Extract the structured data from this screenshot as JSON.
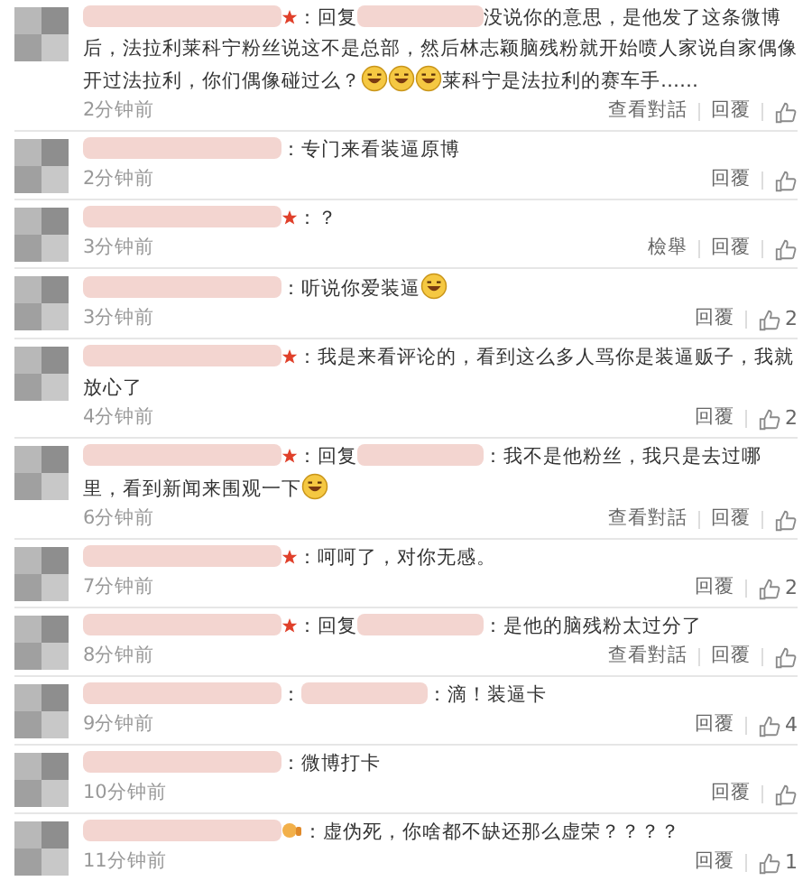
{
  "comments": [
    {
      "starred": true,
      "medal": false,
      "parts": [
        {
          "kind": "text",
          "text": "：回复"
        },
        {
          "kind": "blur"
        },
        {
          "kind": "text",
          "text": "没说你的意思，是他发了这条微博后，法拉利莱科宁粉丝说这不是总部，然后林志颖脑残粉就开始喷人家说自家偶像开过法拉利，你们偶像碰过么？"
        },
        {
          "kind": "emoji"
        },
        {
          "kind": "emoji"
        },
        {
          "kind": "emoji"
        },
        {
          "kind": "text",
          "text": "莱科宁是法拉利的赛车手……"
        }
      ],
      "time": "2分钟前",
      "actions": [
        "查看對話",
        "回覆"
      ]
    },
    {
      "starred": false,
      "medal": false,
      "parts": [
        {
          "kind": "text",
          "text": "：专门来看装逼原博"
        }
      ],
      "time": "2分钟前",
      "actions": [
        "回覆"
      ]
    },
    {
      "starred": true,
      "medal": false,
      "parts": [
        {
          "kind": "text",
          "text": "：？"
        }
      ],
      "time": "3分钟前",
      "actions": [
        "檢舉",
        "回覆"
      ]
    },
    {
      "starred": false,
      "medal": false,
      "parts": [
        {
          "kind": "text",
          "text": "：听说你爱装逼"
        },
        {
          "kind": "emoji"
        }
      ],
      "time": "3分钟前",
      "actions": [
        "回覆"
      ],
      "likes": "2"
    },
    {
      "starred": true,
      "medal": false,
      "parts": [
        {
          "kind": "text",
          "text": "：我是来看评论的，看到这么多人骂你是装逼贩子，我就放心了"
        }
      ],
      "time": "4分钟前",
      "actions": [
        "回覆"
      ],
      "likes": "2"
    },
    {
      "starred": true,
      "medal": false,
      "parts": [
        {
          "kind": "text",
          "text": "：回复"
        },
        {
          "kind": "blur"
        },
        {
          "kind": "text",
          "text": "：我不是他粉丝，我只是去过哪里，看到新闻来围观一下"
        },
        {
          "kind": "emoji"
        }
      ],
      "time": "6分钟前",
      "actions": [
        "查看對話",
        "回覆"
      ]
    },
    {
      "starred": true,
      "medal": false,
      "parts": [
        {
          "kind": "text",
          "text": "：呵呵了，对你无感。"
        }
      ],
      "time": "7分钟前",
      "actions": [
        "回覆"
      ],
      "likes": "2"
    },
    {
      "starred": true,
      "medal": false,
      "parts": [
        {
          "kind": "text",
          "text": "：回复"
        },
        {
          "kind": "blur"
        },
        {
          "kind": "text",
          "text": "：是他的脑残粉太过分了"
        }
      ],
      "time": "8分钟前",
      "actions": [
        "查看對話",
        "回覆"
      ]
    },
    {
      "starred": false,
      "medal": false,
      "parts": [
        {
          "kind": "text",
          "text": "："
        },
        {
          "kind": "blur"
        },
        {
          "kind": "text",
          "text": "：滴！装逼卡"
        }
      ],
      "time": "9分钟前",
      "actions": [
        "回覆"
      ],
      "likes": "4"
    },
    {
      "starred": false,
      "medal": false,
      "parts": [
        {
          "kind": "text",
          "text": "：微博打卡"
        }
      ],
      "time": "10分钟前",
      "actions": [
        "回覆"
      ]
    },
    {
      "starred": false,
      "medal": true,
      "parts": [
        {
          "kind": "text",
          "text": "：虚伪死，你啥都不缺还那么虚荣？？？？"
        }
      ],
      "time": "11分钟前",
      "actions": [
        "回覆"
      ],
      "likes": "1"
    }
  ]
}
